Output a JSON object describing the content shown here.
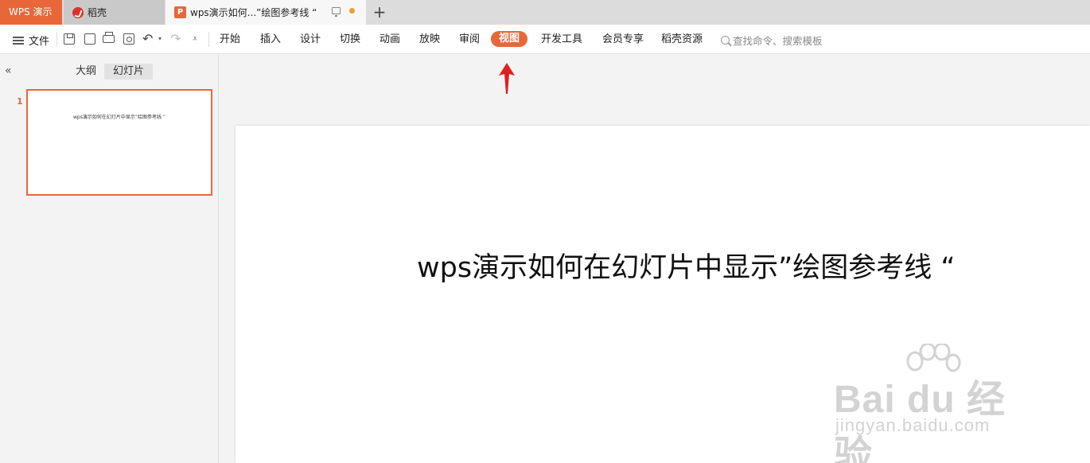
{
  "tabs": {
    "app_label": "WPS 演示",
    "daoke_label": "稻壳",
    "doc_label": "wps演示如何...”绘图参考线 “",
    "doc_logo_letter": "P",
    "new_tab_symbol": "+"
  },
  "ribbon": {
    "file_label": "文件",
    "menus": [
      "开始",
      "插入",
      "设计",
      "切换",
      "动画",
      "放映",
      "审阅",
      "视图",
      "开发工具",
      "会员专享",
      "稻壳资源"
    ],
    "active_menu": "视图",
    "search_placeholder": "查找命令、搜索模板"
  },
  "left_pane": {
    "tab_outline": "大纲",
    "tab_slides": "幻灯片",
    "slide_number": "1",
    "thumb_text": "wps演示如何在幻灯片中显示”绘图参考线 “"
  },
  "slide": {
    "title": "wps演示如何在幻灯片中显示”绘图参考线 “"
  },
  "watermark": {
    "main": "Bai  du 经验",
    "sub": "jingyan.baidu.com"
  },
  "colors": {
    "accent": "#e8673a",
    "annotation_arrow": "#e02020"
  }
}
